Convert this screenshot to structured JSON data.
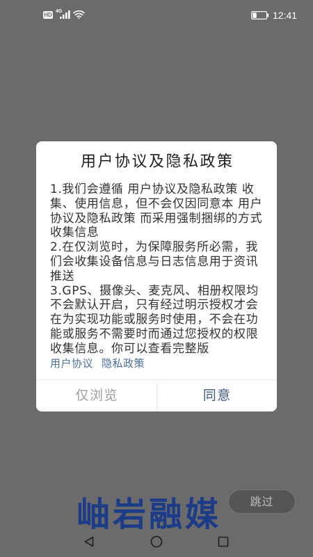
{
  "status_bar": {
    "hd_label": "HD",
    "network_label": "4G",
    "time": "12:41",
    "battery_level": 0.3,
    "icons": {
      "signal": "signal-icon",
      "wifi": "wifi-icon",
      "battery": "battery-icon"
    }
  },
  "dialog": {
    "title": "用户协议及隐私政策",
    "body_lines": [
      "1.我们会遵循 用户协议及隐私政策 收",
      "集、使用信息，但不会仅因同意本 用户",
      "协议及隐私政策 而采用强制捆绑的方式",
      "收集信息",
      "2.在仅浏览时，为保障服务所必需，我",
      "们会收集设备信息与日志信息用于资讯",
      "推送",
      "3.GPS、摄像头、麦克风、相册权限均",
      "不会默认开启，只有经过明示授权才会",
      "在为实现功能或服务时使用，不会在功",
      "能或服务不需要时而通过您授权的权限",
      "收集信息。你可以查看完整版"
    ],
    "links": {
      "user_agreement": "用户协议",
      "privacy_policy": "隐私政策"
    },
    "buttons": {
      "browse_only": "仅浏览",
      "agree": "同意"
    }
  },
  "splash": {
    "logo_text": "岫岩融媒",
    "skip_label": "跳过"
  },
  "nav_bar": {
    "icons": [
      "back-icon",
      "home-icon",
      "recents-icon"
    ]
  },
  "colors": {
    "overlay": "#6b6b6b",
    "link": "#4a6ea6",
    "browse": "#9e9e9e",
    "agree": "#3d5b88",
    "logo": "#1c3c88"
  }
}
